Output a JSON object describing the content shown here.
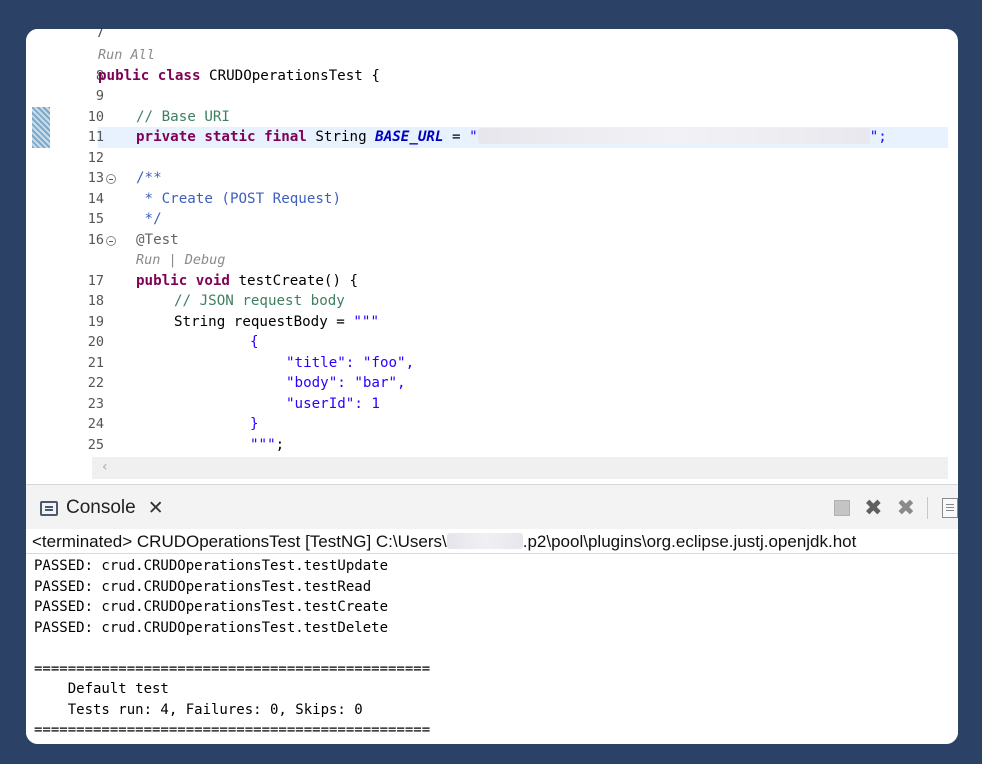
{
  "editor": {
    "line_numbers": [
      "7",
      "8",
      "9",
      "10",
      "11",
      "12",
      "13",
      "14",
      "15",
      "16",
      "17",
      "18",
      "19",
      "20",
      "21",
      "22",
      "23",
      "24",
      "25"
    ],
    "codelens": {
      "run_all": "Run All",
      "run_debug": "Run | Debug"
    },
    "code": {
      "l8_kw": "public class ",
      "l8_rest": "CRUDOperationsTest {",
      "l10": "// Base URI",
      "l11_kw": "private static final ",
      "l11_type": "String ",
      "l11_field": "BASE_URL",
      "l11_eq": " = ",
      "l11_open": "\"",
      "l11_end": "\";",
      "l13": "/**",
      "l14": " * Create (POST Request)",
      "l15": " */",
      "l16": "@Test",
      "l17_kw": "public void ",
      "l17_rest": "testCreate() {",
      "l18": "// JSON request body",
      "l19_a": "String requestBody = ",
      "l19_b": "\"\"\"",
      "l20": "{",
      "l21": "\"title\": \"foo\",",
      "l22": "\"body\": \"bar\",",
      "l23": "\"userId\": 1",
      "l24": "}",
      "l25_a": "\"\"\"",
      "l25_b": ";"
    }
  },
  "console": {
    "tab_label": "Console",
    "status_prefix": "<terminated> CRUDOperationsTest [TestNG] C:\\Users\\",
    "status_suffix": ".p2\\pool\\plugins\\org.eclipse.justj.openjdk.hot",
    "output": [
      "PASSED: crud.CRUDOperationsTest.testUpdate",
      "PASSED: crud.CRUDOperationsTest.testRead",
      "PASSED: crud.CRUDOperationsTest.testCreate",
      "PASSED: crud.CRUDOperationsTest.testDelete",
      "",
      "===============================================",
      "    Default test",
      "    Tests run: 4, Failures: 0, Skips: 0",
      "==============================================="
    ]
  }
}
